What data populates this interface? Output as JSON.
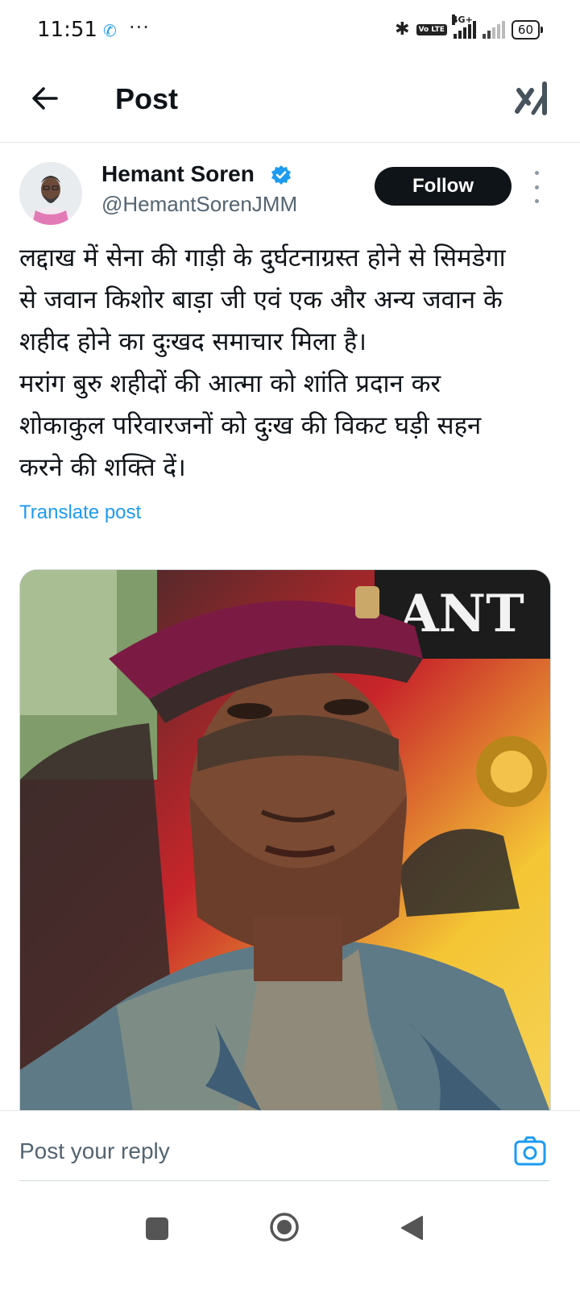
{
  "status_bar": {
    "time": "11:51",
    "call_icon": "phone-icon",
    "more": "···",
    "volte": "Vo LTE",
    "network": "4G+",
    "battery": "60"
  },
  "header": {
    "title": "Post",
    "back_icon": "arrow-left-icon",
    "grok_icon": "grok-icon"
  },
  "post": {
    "author_name": "Hemant Soren",
    "author_handle": "@HemantSorenJMM",
    "verified_icon": "verified-badge-icon",
    "follow_label": "Follow",
    "text_lines": [
      "लद्दाख में सेना की गाड़ी के दुर्घटनाग्रस्त होने से सिमडेगा",
      "से जवान किशोर बाड़ा जी एवं एक और अन्य जवान के",
      "शहीद होने का दुःखद समाचार मिला है।",
      "मरांग बुरु शहीदों की आत्मा को शांति प्रदान कर",
      "शोकाकुल परिवारजनों को दुःख की विकट घड़ी सहन",
      "करने की शक्ति दें।"
    ],
    "translate_label": "Translate post",
    "media_text": "ANT"
  },
  "reply": {
    "placeholder": "Post your reply",
    "camera_icon": "camera-icon"
  },
  "nav": {
    "recent_icon": "square-icon",
    "home_icon": "circle-icon",
    "back_icon": "triangle-back-icon"
  },
  "colors": {
    "accent": "#1d9bf0",
    "text": "#0f1419",
    "muted": "#536471"
  }
}
